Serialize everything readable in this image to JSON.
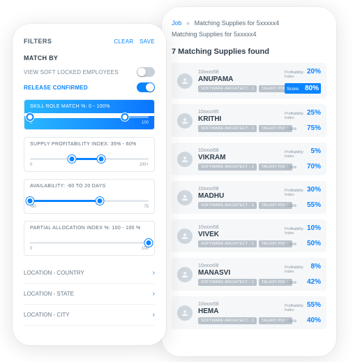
{
  "filters": {
    "title": "FILTERS",
    "clear": "CLEAR",
    "save": "SAVE",
    "match_by": "MATCH BY",
    "soft_locked": {
      "label": "VIEW SOFT LOCKED EMPLOYEES",
      "on": false
    },
    "release_confirmed": {
      "label": "RELEASE CONFIRMED",
      "on": true
    },
    "sliders": [
      {
        "title": "SKILL ROLE MATCH %: 0 - 100%",
        "min": "0",
        "max": "100",
        "low": 0,
        "high": 80,
        "active": true
      },
      {
        "title": "SUPPLY PROFITABILITY INDEX: 35% - 60%",
        "min": "0",
        "max": "100+",
        "low": 35,
        "high": 60,
        "active": false
      },
      {
        "title": "AVAILABILITY: -60 TO 20 DAYS",
        "min": "-60",
        "max": "75",
        "low": 0,
        "high": 59,
        "active": false
      },
      {
        "title": "PARTIAL ALLOCATION INDEX %: 100 - 100 %",
        "min": "0",
        "max": "100",
        "low": 100,
        "high": 100,
        "active": false
      }
    ],
    "locations": [
      {
        "label": "LOCATION - COUNTRY"
      },
      {
        "label": "LOCATION - STATE"
      },
      {
        "label": "LOCATION - CITY"
      }
    ]
  },
  "results": {
    "crumb_job": "Job",
    "crumb_text": "Matching Supplies for  5xxxxx4",
    "sub": "Matching Supplies for  5xxxxx4",
    "found": "7 Matching Supplies found",
    "tag_role": "SOFTWARE ARCHITECT - 1",
    "tag_pool": "TALENT POOL",
    "pi_label": "Profitability Index",
    "score_label": "Score",
    "items": [
      {
        "id": "10xxxx58",
        "name": "ANUPAMA",
        "pi": "20%",
        "score": "80%",
        "featured": true
      },
      {
        "id": "10xxxx95",
        "name": "KRITHI",
        "pi": "25%",
        "score": "75%",
        "featured": false
      },
      {
        "id": "10xxxx58",
        "name": "VIKRAM",
        "pi": "5%",
        "score": "70%",
        "featured": false
      },
      {
        "id": "10xxxx58",
        "name": "MADHU",
        "pi": "30%",
        "score": "55%",
        "featured": false
      },
      {
        "id": "10xxxx58",
        "name": "VIVEK",
        "pi": "10%",
        "score": "50%",
        "featured": false
      },
      {
        "id": "10xxxx58",
        "name": "MANASVI",
        "pi": "8%",
        "score": "42%",
        "featured": false
      },
      {
        "id": "10xxxx58",
        "name": "HEMA",
        "pi": "55%",
        "score": "40%",
        "featured": false
      }
    ]
  }
}
